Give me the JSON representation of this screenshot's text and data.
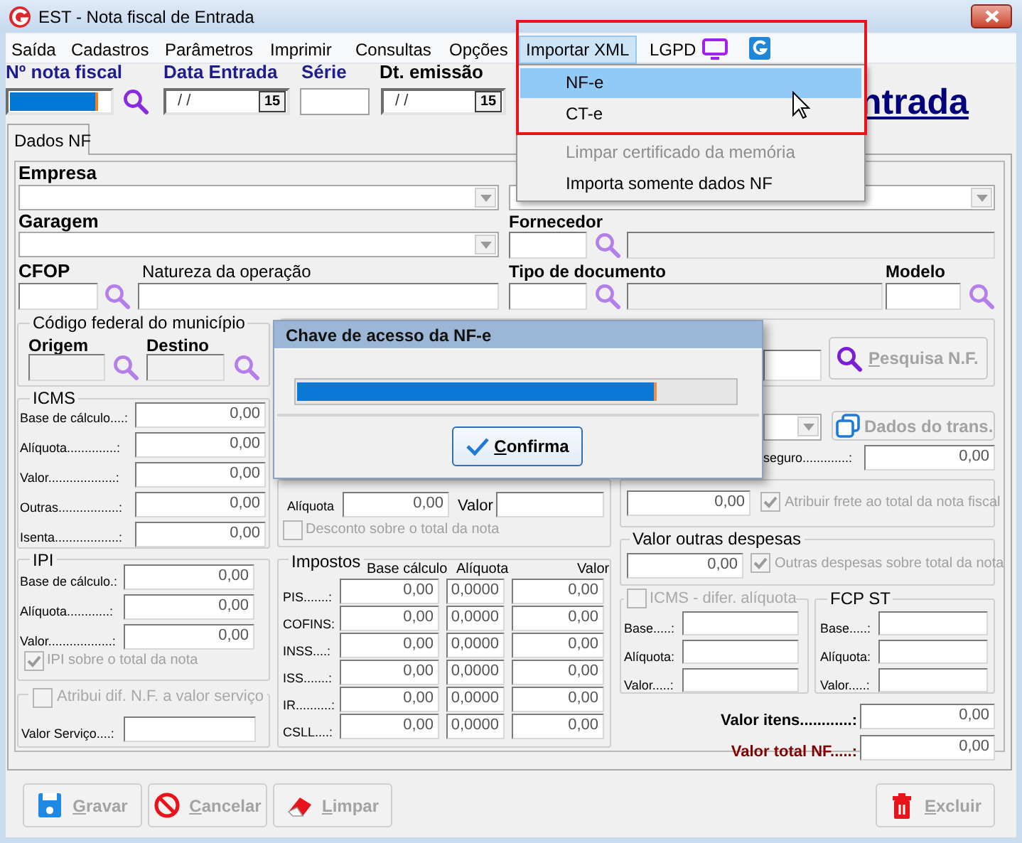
{
  "window": {
    "title": "EST - Nota fiscal de Entrada"
  },
  "menu_bar": [
    {
      "label": "Saída",
      "selected": false
    },
    {
      "label": "Cadastros",
      "selected": false
    },
    {
      "label": "Parâmetros",
      "selected": false
    },
    {
      "label": "Imprimir",
      "selected": false
    },
    {
      "label": "Consultas",
      "selected": false
    },
    {
      "label": "Opções",
      "selected": false
    },
    {
      "label": "Importar XML",
      "selected": true
    },
    {
      "label": "LGPD",
      "selected": false
    }
  ],
  "header": {
    "nota_fiscal": {
      "label": "Nº nota fiscal",
      "selected": true
    },
    "data_entrada": {
      "label": "Data Entrada",
      "value": "/ /",
      "calendar": "15"
    },
    "serie": {
      "label": "Série"
    },
    "dt_emissao": {
      "label": "Dt. emissão",
      "value": "/ /",
      "calendar": "15"
    },
    "title": "ntrada"
  },
  "tabs": [
    {
      "label": "Dados NF",
      "selected": true
    }
  ],
  "fields": {
    "empresa": "Empresa",
    "garagem": "Garagem",
    "cfop": "CFOP",
    "natureza": "Natureza da operação",
    "fornecedor": "Fornecedor",
    "tipo_documento": "Tipo de documento",
    "modelo": "Modelo"
  },
  "municipio": {
    "title": "Código federal do município",
    "origem": "Origem",
    "destino": "Destino"
  },
  "pesquisa_button": {
    "label": "Pesquisa N.F.",
    "disabled": true
  },
  "icms": {
    "title": "ICMS",
    "rows": [
      {
        "label": "Base de cálculo....:",
        "value": "0,00"
      },
      {
        "label": "Alíquota..............:",
        "value": "0,00"
      },
      {
        "label": "Valor...................:",
        "value": "0,00"
      },
      {
        "label": "Outras.................:",
        "value": "0,00"
      },
      {
        "label": "Isenta..................:",
        "value": "0,00"
      }
    ]
  },
  "desconto": {
    "aliquota_label": "Alíquota",
    "aliquota": "0,00",
    "valor_label": "Valor",
    "checkbox": {
      "label": "Desconto sobre o total da nota",
      "checked": false
    }
  },
  "transporte": {
    "button": {
      "label": "Dados do trans.",
      "disabled": true
    },
    "seguro_label": "seguro.............:",
    "seguro": "0,00"
  },
  "frete": {
    "value": "0,00",
    "checkbox": {
      "label": "Atribuir frete ao total da nota fiscal",
      "checked": true
    }
  },
  "outras_despesas": {
    "title": "Valor outras despesas",
    "value": "0,00",
    "checkbox": {
      "label": "Outras despesas sobre total da nota",
      "checked": true
    }
  },
  "ipi": {
    "title": "IPI",
    "rows": [
      {
        "label": "Base de cálculo.:",
        "value": "0,00"
      },
      {
        "label": "Alíquota............:",
        "value": "0,00"
      },
      {
        "label": "Valor..................:",
        "value": "0,00"
      }
    ],
    "checkbox": {
      "label": "IPI sobre o total da nota",
      "checked": true
    }
  },
  "servico": {
    "checkbox": {
      "label": "Atribui dif. N.F. a valor serviço",
      "checked": false
    },
    "label": "Valor Serviço....:"
  },
  "impostos": {
    "title": "Impostos",
    "columns": [
      "Base cálculo",
      "Alíquota",
      "Valor"
    ],
    "rows": [
      {
        "label": "PIS.......:",
        "base": "0,00",
        "aliquota": "0,0000",
        "valor": "0,00"
      },
      {
        "label": "COFINS:",
        "base": "0,00",
        "aliquota": "0,0000",
        "valor": "0,00"
      },
      {
        "label": "INSS....:",
        "base": "0,00",
        "aliquota": "0,0000",
        "valor": "0,00"
      },
      {
        "label": "ISS.......:",
        "base": "0,00",
        "aliquota": "0,0000",
        "valor": "0,00"
      },
      {
        "label": "IR..........:",
        "base": "0,00",
        "aliquota": "0,0000",
        "valor": "0,00"
      },
      {
        "label": "CSLL....:",
        "base": "0,00",
        "aliquota": "0,0000",
        "valor": "0,00"
      }
    ]
  },
  "icms_difer": {
    "checkbox": {
      "label": "ICMS - difer. alíquota",
      "checked": false
    },
    "rows": [
      "Base.....:",
      "Alíquota:",
      "Valor.....:"
    ]
  },
  "fcp_st": {
    "title": "FCP ST",
    "rows": [
      "Base.....:",
      "Alíquota:",
      "Valor.....:"
    ]
  },
  "totals": [
    {
      "label": "Valor itens............:",
      "value": "0,00",
      "kind": "normal"
    },
    {
      "label": "Valor total NF.....:",
      "value": "0,00",
      "kind": "highlight"
    }
  ],
  "buttons": [
    {
      "label": "Gravar",
      "kind": "save",
      "disabled": true
    },
    {
      "label": "Cancelar",
      "kind": "cancel",
      "disabled": true
    },
    {
      "label": "Limpar",
      "kind": "clear",
      "disabled": true
    },
    {
      "label": "Excluir",
      "kind": "delete",
      "disabled": true
    }
  ],
  "dropdown": [
    {
      "label": "NF-e",
      "selected": true,
      "disabled": false
    },
    {
      "label": "CT-e",
      "selected": false,
      "disabled": false
    },
    {
      "label": "Limpar certificado da memória",
      "selected": false,
      "disabled": true
    },
    {
      "label": "Importa somente dados NF",
      "selected": false,
      "disabled": false
    }
  ],
  "dialog": {
    "title": "Chave de acesso da NF-e",
    "progress": {
      "level": 0.82
    },
    "button": "Confirma"
  }
}
